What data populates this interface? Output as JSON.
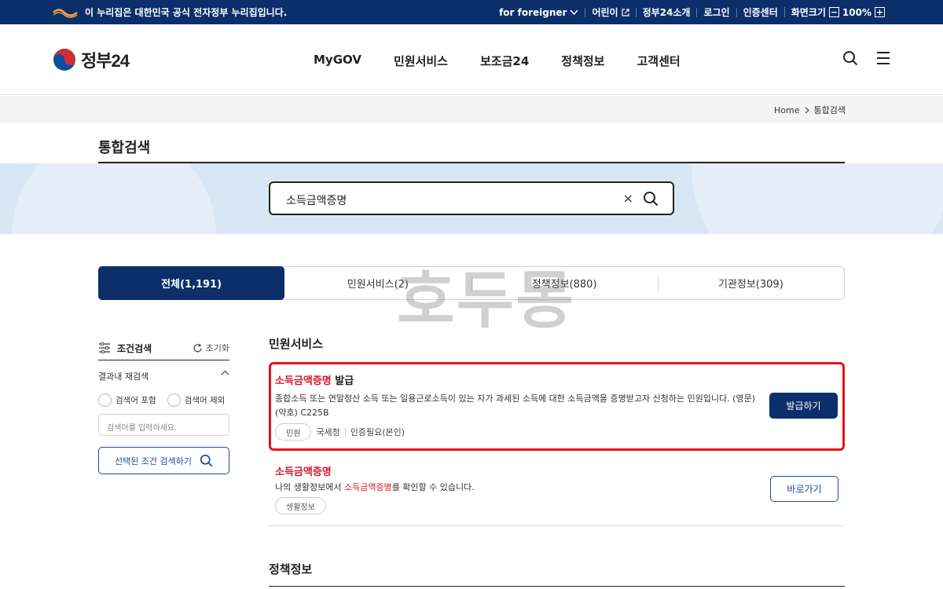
{
  "top_banner": {
    "official_text": "이 누리집은 대한민국 공식 전자정부 누리집입니다.",
    "links": [
      "for foreigner",
      "어린이",
      "정부24소개",
      "로그인",
      "인증센터"
    ],
    "font_size_label": "화면크기",
    "zoom": "100%",
    "zoom_minus": "−",
    "zoom_plus": "+"
  },
  "header": {
    "logo_text": "정부24",
    "nav": [
      "MyGOV",
      "민원서비스",
      "보조금24",
      "정책정보",
      "고객센터"
    ]
  },
  "breadcrumb": {
    "home": "Home",
    "current": "통합검색"
  },
  "page_title": "통합검색",
  "search": {
    "query": "소득금액증명",
    "clear": "×"
  },
  "watermark": "호두몽",
  "tabs": [
    {
      "label": "전체(1,191)",
      "active": true
    },
    {
      "label": "민원서비스(2)",
      "active": false
    },
    {
      "label": "정책정보(880)",
      "active": false
    },
    {
      "label": "기관정보(309)",
      "active": false
    }
  ],
  "filter": {
    "title": "조건검색",
    "reset": "초기화",
    "refine_title": "결과내 재검색",
    "include": "검색어 포함",
    "exclude": "검색어 제외",
    "placeholder": "검색어를 입력하세요.",
    "submit": "선택된 조건 검색하기"
  },
  "sections": {
    "civil": "민원서비스",
    "policy": "정책정보"
  },
  "results": [
    {
      "title_highlight": "소득금액증명",
      "title_rest": " 발급",
      "desc": "종합소득 또는 연말정산 소득 또는 일용근로소득이 있는 자가 과세된 소득에 대한 소득금액을 증명받고자 신청하는 민원입니다. (영문)(약호) C225B",
      "chip": "민원",
      "agency": "국세청",
      "auth": "인증필요(본인)",
      "button": "발급하기"
    },
    {
      "title_highlight": "소득금액증명",
      "desc_pre": "나의 생활정보에서 ",
      "desc_highlight": "소득금액증명",
      "desc_post": "를 확인할 수 있습니다.",
      "chip": "생활정보",
      "button": "바로가기"
    }
  ],
  "colors": {
    "navy": "#0c2f6b",
    "highlight_red": "#d8152a",
    "outline_red": "#e3141b",
    "band_blue": "#d9e6f6"
  }
}
